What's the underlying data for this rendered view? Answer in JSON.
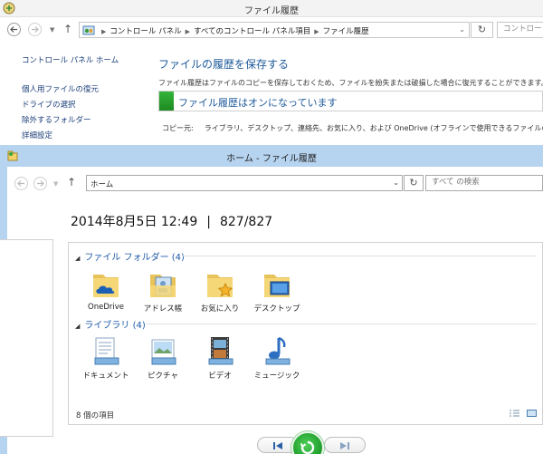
{
  "bg_window": {
    "title": "ファイル履歴",
    "breadcrumbs": [
      "コントロール パネル",
      "すべてのコントロール パネル項目",
      "ファイル履歴"
    ],
    "search_placeholder": "コントロー",
    "side": {
      "home": "コントロール パネル ホーム",
      "links": [
        "個人用ファイルの復元",
        "ドライブの選択",
        "除外するフォルダー",
        "詳細設定"
      ]
    },
    "heading": "ファイルの履歴を保存する",
    "description": "ファイル履歴はファイルのコピーを保存しておくため、ファイルを紛失または破損した場合に復元することができます。",
    "status": "ファイル履歴はオンになっています",
    "copy_from_label": "コピー元:",
    "copy_from_value": "ライブラリ、デスクトップ、連絡先、お気に入り、および OneDrive (オフラインで使用できるファイルのみ)"
  },
  "fg_window": {
    "title": "ホーム - ファイル履歴",
    "address": "ホーム",
    "search_placeholder": "すべて の検索",
    "date": "2014年8月5日 12:49",
    "pipe": "|",
    "version": "827/827",
    "groups": [
      {
        "label": "ファイル フォルダー (4)",
        "items": [
          {
            "label": "OneDrive",
            "icon": "onedrive-folder-icon"
          },
          {
            "label": "アドレス帳",
            "icon": "contacts-folder-icon"
          },
          {
            "label": "お気に入り",
            "icon": "favorites-folder-icon"
          },
          {
            "label": "デスクトップ",
            "icon": "desktop-folder-icon"
          }
        ]
      },
      {
        "label": "ライブラリ (4)",
        "items": [
          {
            "label": "ドキュメント",
            "icon": "documents-library-icon"
          },
          {
            "label": "ピクチャ",
            "icon": "pictures-library-icon"
          },
          {
            "label": "ビデオ",
            "icon": "videos-library-icon"
          },
          {
            "label": "ミュージック",
            "icon": "music-library-icon"
          }
        ]
      }
    ],
    "item_count": "8 個の項目"
  },
  "colors": {
    "link_blue": "#1e5a9a",
    "title_bar_blue": "#b6d3ef",
    "restore_green": "#1f9b2a"
  }
}
